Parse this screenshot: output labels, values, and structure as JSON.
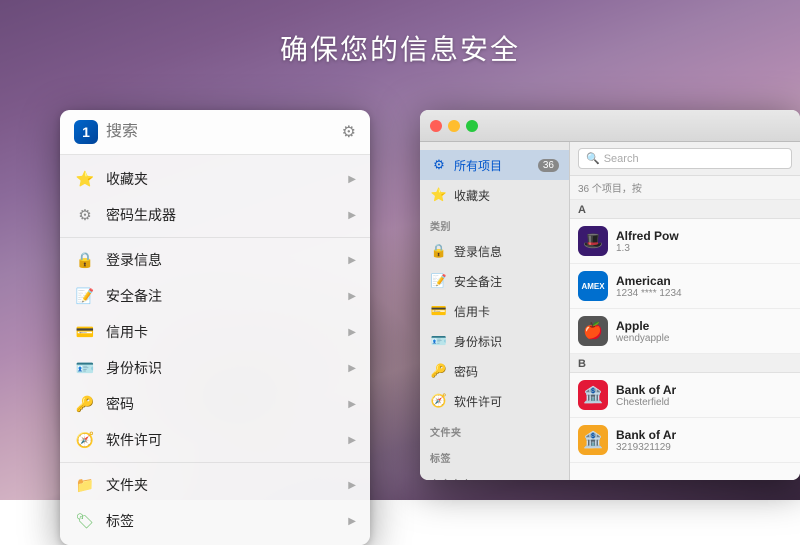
{
  "page": {
    "title": "确保您的信息安全"
  },
  "popup": {
    "logo_label": "1",
    "search_placeholder": "搜索",
    "gear_label": "⚙",
    "items": [
      {
        "id": "favorites",
        "icon": "⭐",
        "icon_class": "icon-star",
        "label": "收藏夹",
        "has_arrow": true
      },
      {
        "id": "password-gen",
        "icon": "⚙",
        "icon_class": "icon-gear",
        "label": "密码生成器",
        "has_arrow": true
      },
      {
        "id": "divider1",
        "type": "divider"
      },
      {
        "id": "logins",
        "icon": "🔒",
        "icon_class": "icon-lock",
        "label": "登录信息",
        "has_arrow": true
      },
      {
        "id": "notes",
        "icon": "📝",
        "icon_class": "icon-note",
        "label": "安全备注",
        "has_arrow": true
      },
      {
        "id": "cards",
        "icon": "💳",
        "icon_class": "icon-card",
        "label": "信用卡",
        "has_arrow": true
      },
      {
        "id": "identity",
        "icon": "🪪",
        "icon_class": "icon-id",
        "label": "身份标识",
        "has_arrow": true
      },
      {
        "id": "passwords",
        "icon": "🔑",
        "icon_class": "icon-key",
        "label": "密码",
        "has_arrow": true
      },
      {
        "id": "software",
        "icon": "🧭",
        "icon_class": "icon-compass",
        "label": "软件许可",
        "has_arrow": true
      },
      {
        "id": "divider2",
        "type": "divider"
      },
      {
        "id": "folders",
        "icon": "📁",
        "icon_class": "icon-folder",
        "label": "文件夹",
        "has_arrow": true
      },
      {
        "id": "tags",
        "icon": "🏷",
        "icon_class": "icon-tag",
        "label": "标签",
        "has_arrow": true
      }
    ]
  },
  "main_window": {
    "traffic_lights": [
      "red",
      "yellow",
      "green"
    ],
    "sidebar": {
      "all_items_label": "所有项目",
      "all_items_count": "36",
      "favorites_label": "收藏夹",
      "section_category": "类别",
      "section_folder": "文件夹",
      "section_tag": "标签",
      "section_audit": "安全审查",
      "categories": [
        {
          "id": "logins",
          "icon": "🔒",
          "label": "登录信息"
        },
        {
          "id": "notes",
          "icon": "📝",
          "label": "安全备注"
        },
        {
          "id": "cards",
          "icon": "💳",
          "label": "信用卡"
        },
        {
          "id": "identity",
          "icon": "🪪",
          "label": "身份标识"
        },
        {
          "id": "passwords",
          "icon": "🔑",
          "label": "密码"
        },
        {
          "id": "software",
          "icon": "🧭",
          "label": "软件许可"
        }
      ]
    },
    "content": {
      "search_placeholder": "Search",
      "status": "36 个项目，按",
      "section_a": "A",
      "section_b": "B",
      "items": [
        {
          "id": "alfred",
          "name": "Alfred Pow",
          "sub": "1.3",
          "icon_bg": "icon-alfred",
          "icon_char": "🎩",
          "section": "A"
        },
        {
          "id": "amex",
          "name": "American",
          "sub": "1234 **** 1234",
          "icon_bg": "icon-amex",
          "icon_char": "💳",
          "section": "A"
        },
        {
          "id": "apple",
          "name": "Apple",
          "sub": "wendyapple",
          "icon_bg": "icon-apple",
          "icon_char": "🍎",
          "section": "A"
        },
        {
          "id": "bankofamerica",
          "name": "Bank of Ar",
          "sub": "Chesterfield",
          "icon_bg": "icon-bankofamerica",
          "icon_char": "🏦",
          "section": "B"
        },
        {
          "id": "bankofar2",
          "name": "Bank of Ar",
          "sub": "3219321129",
          "icon_bg": "icon-bankofar",
          "icon_char": "🏦",
          "section": "B"
        }
      ]
    }
  }
}
